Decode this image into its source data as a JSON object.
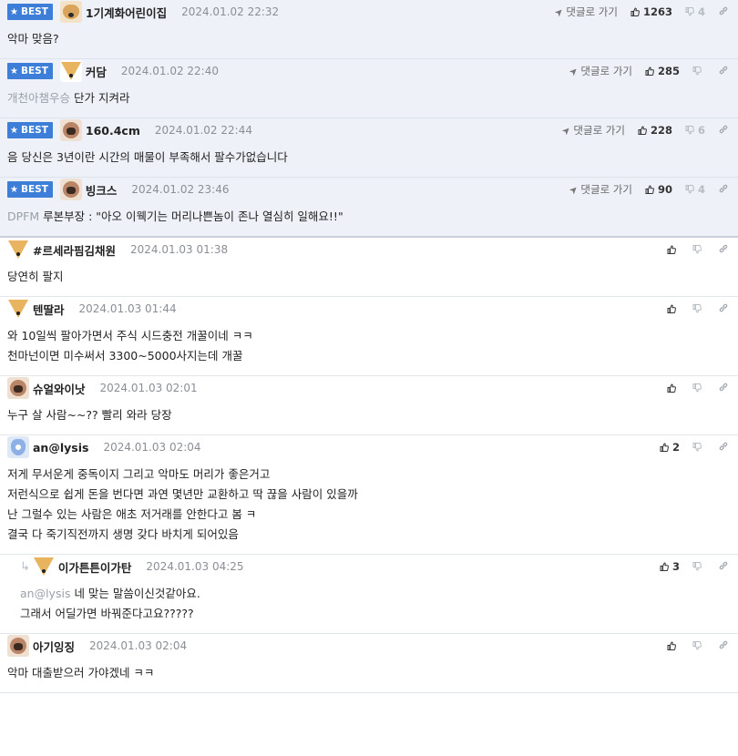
{
  "labels": {
    "best": "BEST",
    "goto": "댓글로 가기"
  },
  "comments": [
    {
      "best": true,
      "avatar": "dog",
      "nick": "1기계화어린이집",
      "date": "2024.01.02 22:32",
      "up": "1263",
      "down": "4",
      "ref": "",
      "lines": [
        "악마 맞음?"
      ]
    },
    {
      "best": true,
      "avatar": "fox",
      "nick": "커담",
      "date": "2024.01.02 22:40",
      "up": "285",
      "down": "",
      "ref": "개천아챔우승",
      "lines": [
        "단가 지켜라"
      ]
    },
    {
      "best": true,
      "avatar": "pug",
      "nick": "160.4cm",
      "date": "2024.01.02 22:44",
      "up": "228",
      "down": "6",
      "ref": "",
      "lines": [
        "음 당신은 3년이란 시간의 매물이 부족해서 팔수가없습니다"
      ]
    },
    {
      "best": true,
      "avatar": "pug",
      "nick": "빙크스",
      "date": "2024.01.02 23:46",
      "up": "90",
      "down": "4",
      "ref": "DPFM",
      "lines": [
        "루본부장 : \"아오 이웩기는 머리나쁜놈이 존나 열심히 일해요!!\""
      ]
    },
    {
      "best": false,
      "avatar": "fox",
      "nick": "#르세라핌김채원",
      "date": "2024.01.03 01:38",
      "up": "",
      "down": "",
      "ref": "",
      "lines": [
        "당연히 팔지"
      ]
    },
    {
      "best": false,
      "avatar": "fox",
      "nick": "텐딸라",
      "date": "2024.01.03 01:44",
      "up": "",
      "down": "",
      "ref": "",
      "lines": [
        "와 10일씩 팔아가면서 주식 시드충전 개꿀이네 ㅋㅋ",
        "천마넌이면 미수써서 3300~5000사지는데 개꿀"
      ]
    },
    {
      "best": false,
      "avatar": "pug",
      "nick": "슈얼와이낫",
      "date": "2024.01.03 02:01",
      "up": "",
      "down": "",
      "ref": "",
      "lines": [
        "누구 살 사람~~?? 빨리 와라 당장"
      ]
    },
    {
      "best": false,
      "avatar": "blue",
      "nick": "an@lysis",
      "date": "2024.01.03 02:04",
      "up": "2",
      "down": "",
      "ref": "",
      "lines": [
        "저게 무서운게 중독이지 그리고 악마도 머리가 좋은거고",
        "저런식으로 쉽게 돈을 번다면 과연 몇년만 교환하고 딱 끊을 사람이 있을까",
        "난 그럴수 있는 사람은 애초 저거래를 안한다고 봄 ㅋ",
        "결국 다 죽기직전까지 생명 갖다 바치게 되어있음"
      ]
    },
    {
      "best": false,
      "reply": true,
      "avatar": "fox",
      "nick": "이가튼튼이가탄",
      "date": "2024.01.03 04:25",
      "up": "3",
      "down": "",
      "ref": "an@lysis",
      "lines": [
        "네 맞는 말씀이신것같아요.",
        "그래서 어딜가면 바꿔준다고요?????"
      ]
    },
    {
      "best": false,
      "avatar": "pug",
      "nick": "아기잉징",
      "date": "2024.01.03 02:04",
      "up": "",
      "down": "",
      "ref": "",
      "lines": [
        "악마 대출받으러 가야겠네 ㅋㅋ"
      ]
    }
  ]
}
